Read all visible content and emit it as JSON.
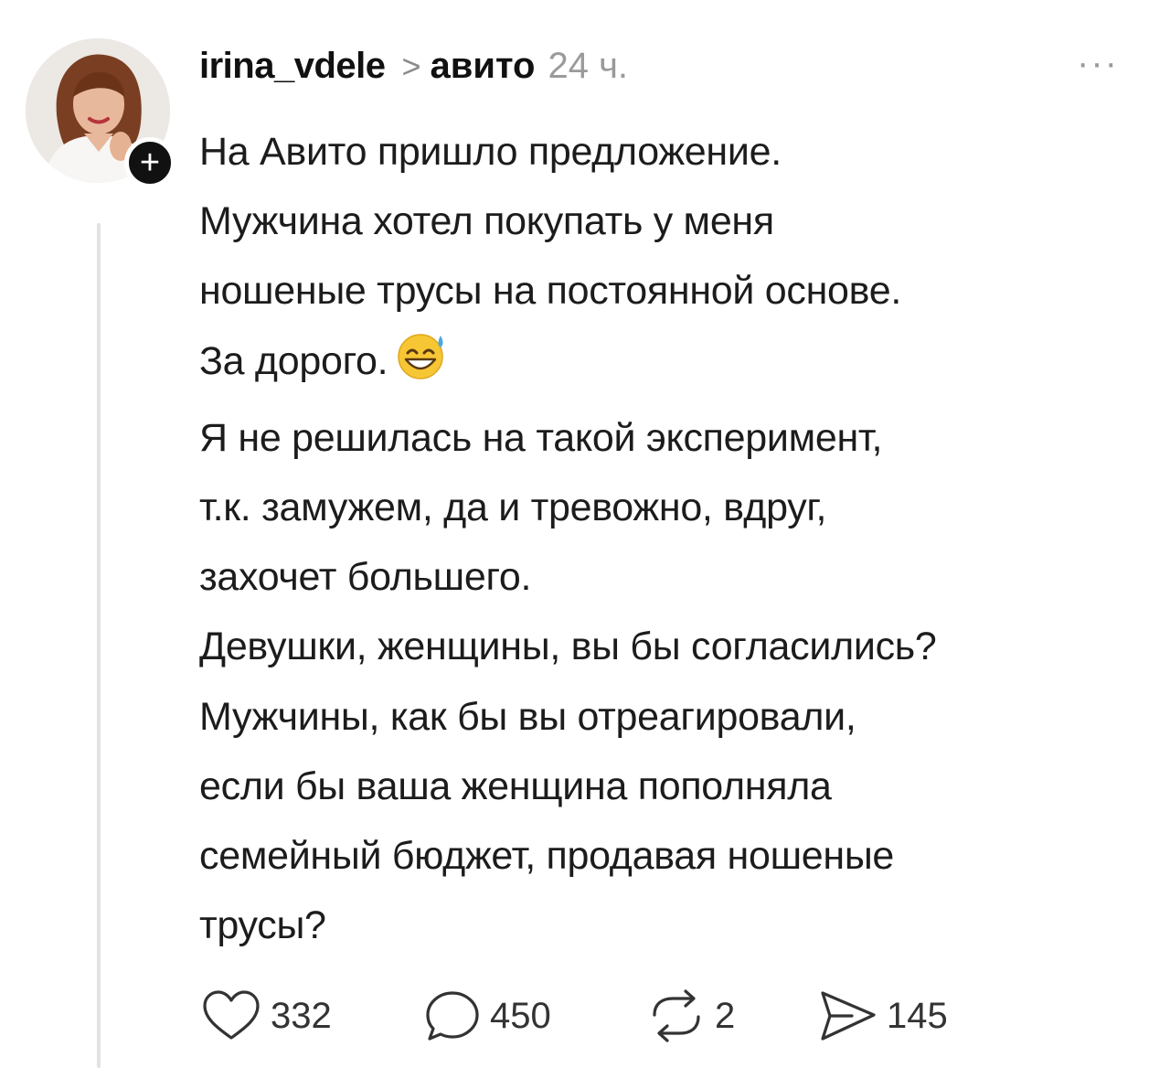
{
  "post": {
    "author": {
      "username": "irina_vdele"
    },
    "community": "авито",
    "time": "24 ч.",
    "more_label": "···",
    "follow_badge": "+",
    "text_lines": [
      "На Авито пришло предложение.",
      "Мужчина хотел покупать у меня",
      "ношеные трусы на постоянной основе.",
      "За дорого.",
      "Я не решилась на такой эксперимент,",
      "т.к. замужем, да и тревожно, вдруг,",
      "захочет большего.",
      "Девушки, женщины, вы бы согласились?",
      "Мужчины, как бы вы отреагировали,",
      "если бы ваша женщина пополняла",
      "семейный бюджет, продавая ношеные",
      "трусы?"
    ],
    "emoji_after_line": 3,
    "emoji_icon": "grinning-face-with-sweat-icon"
  },
  "actions": {
    "likes": "332",
    "comments": "450",
    "reposts": "2",
    "shares": "145"
  },
  "colors": {
    "text": "#1c1c1c",
    "muted": "#9a9a9a",
    "badge": "#111111",
    "thread_line": "#e3e3e3"
  }
}
